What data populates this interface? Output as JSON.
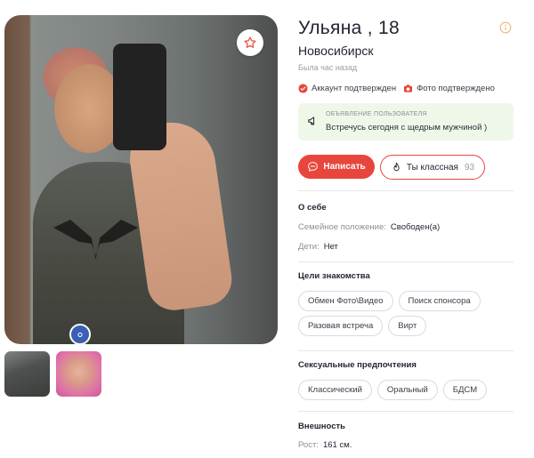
{
  "profile": {
    "name_age": "Ульяна , 18",
    "city": "Новосибирск",
    "last_seen": "Была час назад",
    "badges": {
      "account": "Аккаунт подтвержден",
      "photo": "Фото подтверждено"
    }
  },
  "announcement": {
    "label": "ОБЪЯВЛЕНИЕ ПОЛЬЗОВАТЕЛЯ",
    "text": "Встречусь сегодня с щедрым мужчиной )"
  },
  "actions": {
    "write_label": "Написать",
    "like_label": "Ты классная",
    "like_count": "93"
  },
  "about": {
    "title": "О себе",
    "marital_label": "Семейное положение:",
    "marital_value": "Свободен(а)",
    "kids_label": "Дети:",
    "kids_value": "Нет"
  },
  "goals": {
    "title": "Цели знакомства",
    "items": [
      "Обмен Фото\\Видео",
      "Поиск спонсора",
      "Разовая встреча",
      "Вирт"
    ]
  },
  "preferences": {
    "title": "Сексуальные предпочтения",
    "items": [
      "Классический",
      "Оральный",
      "БДСМ"
    ]
  },
  "appearance": {
    "title": "Внешность",
    "height_label": "Рост:",
    "height_value": "161 см."
  },
  "colors": {
    "accent": "#e8463d",
    "verified": "#e8463d",
    "announce_bg": "#eff7e9",
    "chip_border": "#d9dbdf"
  },
  "icons": {
    "favorite": "star-icon",
    "info": "info-icon",
    "verified": "check-circle-icon",
    "photo": "camera-icon",
    "announce": "megaphone-icon",
    "write": "chat-bubble-icon",
    "like": "flame-icon"
  }
}
